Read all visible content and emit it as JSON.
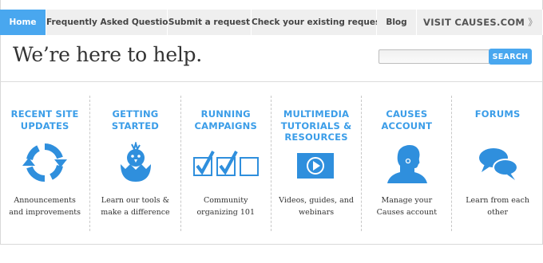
{
  "nav": {
    "tabs": [
      {
        "label": "Home"
      },
      {
        "label": "Frequently Asked Questions"
      },
      {
        "label": "Submit a request"
      },
      {
        "label": "Check your existing requests"
      },
      {
        "label": "Blog"
      }
    ],
    "visit_label": "VISIT CAUSES.COM",
    "visit_chevron": "》"
  },
  "header": {
    "headline": "We’re here to help.",
    "search_placeholder": "",
    "search_button": "SEARCH"
  },
  "colors": {
    "accent": "#49a7ef",
    "title_blue": "#3b9de8",
    "icon_blue": "#2f8fdd"
  },
  "columns": [
    {
      "title_line1": "RECENT SITE",
      "title_line2": "UPDATES",
      "title_line3": "",
      "icon": "refresh-icon",
      "desc_line1": "Announcements",
      "desc_line2": "and improvements"
    },
    {
      "title_line1": "GETTING",
      "title_line2": "STARTED",
      "title_line3": "",
      "icon": "chick-icon",
      "desc_line1": "Learn our tools &",
      "desc_line2": "make a difference"
    },
    {
      "title_line1": "RUNNING",
      "title_line2": "CAMPAIGNS",
      "title_line3": "",
      "icon": "checkboxes-icon",
      "desc_line1": "Community",
      "desc_line2": "organizing 101"
    },
    {
      "title_line1": "MULTIMEDIA",
      "title_line2": "TUTORIALS &",
      "title_line3": "RESOURCES",
      "icon": "video-play-icon",
      "desc_line1": "Videos, guides, and",
      "desc_line2": "webinars"
    },
    {
      "title_line1": "CAUSES",
      "title_line2": "ACCOUNT",
      "title_line3": "",
      "icon": "user-profile-icon",
      "desc_line1": "Manage your",
      "desc_line2": "Causes account"
    },
    {
      "title_line1": "FORUMS",
      "title_line2": "",
      "title_line3": "",
      "icon": "chat-bubbles-icon",
      "desc_line1": "Learn from each",
      "desc_line2": "other"
    }
  ]
}
